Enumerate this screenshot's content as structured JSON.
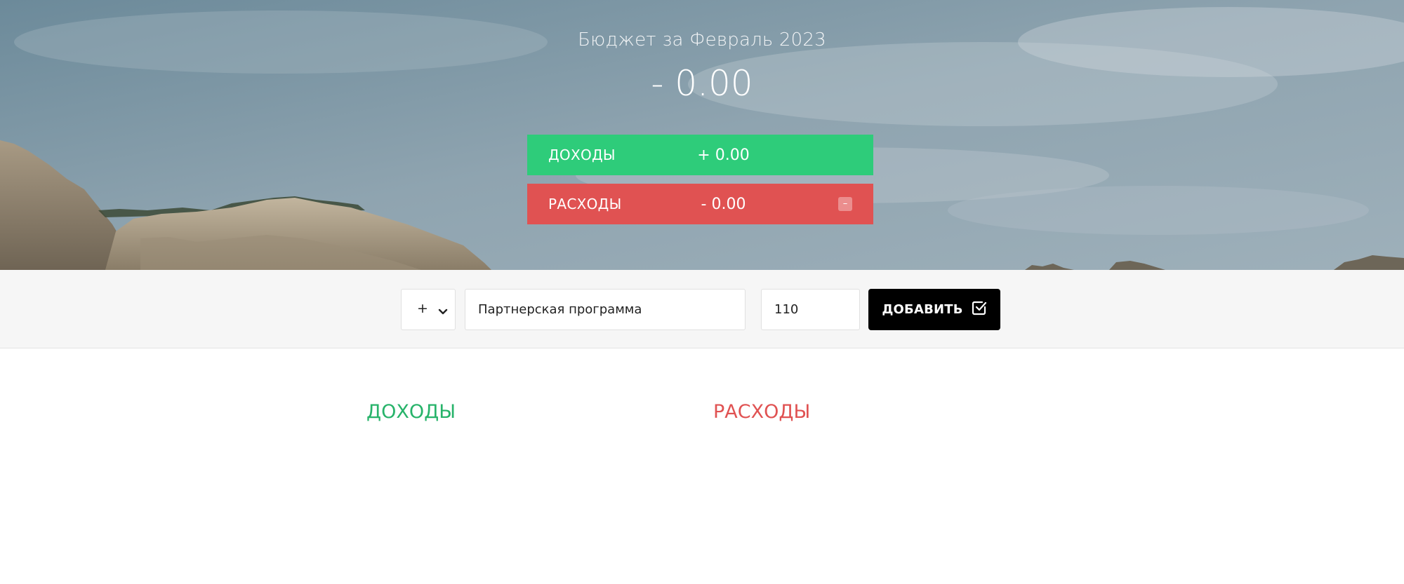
{
  "header": {
    "title": "Бюджет за Февраль 2023",
    "total": "- 0.00"
  },
  "summary": {
    "income": {
      "label": "ДОХОДЫ",
      "value": "+ 0.00",
      "color": "#2ecc7a"
    },
    "expense": {
      "label": "РАСХОДЫ",
      "value": "- 0.00",
      "percentage": "–",
      "color": "#e05252"
    }
  },
  "add_form": {
    "type_select": {
      "selected": "+",
      "icon": "chevron-down-icon"
    },
    "description": {
      "value": "Партнерская программа"
    },
    "amount": {
      "value": "110"
    },
    "button": {
      "label": "ДОБАВИТЬ",
      "icon": "checkbox-edit-icon"
    }
  },
  "lists": {
    "income_title": "ДОХОДЫ",
    "expense_title": "РАСХОДЫ"
  },
  "colors": {
    "income": "#27b36a",
    "expense": "#e05252",
    "button": "#000000"
  }
}
